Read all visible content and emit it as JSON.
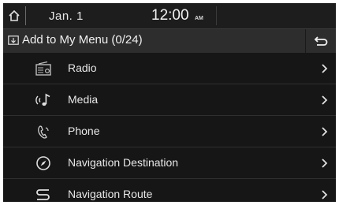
{
  "status": {
    "home_icon": "home-icon",
    "date": "Jan. 1",
    "time": "12:00",
    "ampm": "AM"
  },
  "header": {
    "title": "Add to My Menu (0/24)",
    "title_icon": "add-menu-icon",
    "back_icon": "back-arrow-icon"
  },
  "menu": {
    "items": [
      {
        "label": "Radio",
        "icon": "radio-icon"
      },
      {
        "label": "Media",
        "icon": "media-icon"
      },
      {
        "label": "Phone",
        "icon": "phone-icon"
      },
      {
        "label": "Navigation Destination",
        "icon": "navigation-destination-icon"
      },
      {
        "label": "Navigation Route",
        "icon": "navigation-route-icon"
      }
    ]
  },
  "colors": {
    "background": "#161616",
    "text": "#e8e8e8",
    "titlebar": "#2d2d2d"
  }
}
